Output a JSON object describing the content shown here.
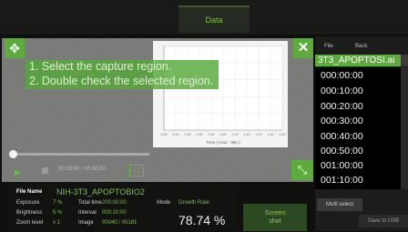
{
  "header": {
    "active_tab": "Data"
  },
  "preview": {
    "move_icon": "move-arrows-icon",
    "close_icon": "close-x-icon",
    "resize_icon": "resize-diagonal-icon",
    "instructions": [
      "1. Select the capture region.",
      "2. Double check the selected region."
    ]
  },
  "mini_chart": {
    "x_axis_label": "Time ( Hour : Min )",
    "x_ticks": [
      "0:00",
      "0:10",
      "0:20",
      "0:30",
      "0:40",
      "0:50",
      "1:00",
      "1:10",
      "1:20",
      "1:30",
      "1:40"
    ]
  },
  "playback": {
    "play_icon": "play-icon",
    "stop_icon": "stop-icon",
    "time_readout": "00:00:00 / 00:00:00",
    "snapshot_icon": "snapshot-icon",
    "progress": 0.0
  },
  "info": {
    "file_name_label": "File Name",
    "file_name": "NIH-3T3_APOPTOBIO2",
    "exposure_label": "Exposure",
    "exposure_value": "7 %",
    "brightness_label": "Brightness",
    "brightness_value": "5 %",
    "zoom_label": "Zoom level",
    "zoom_value": "x 1",
    "total_time_label": "Total time",
    "total_time_value": "200:00:00",
    "interval_label": "Interval",
    "interval_value": "000:10:00",
    "image_label": "Image",
    "image_value": "00040 / 00181",
    "mode_label": "Mode",
    "mode_value": "Growth Rate",
    "percent": "78.74 %"
  },
  "screenshot_button": {
    "line1": "Screen",
    "line2": "shot"
  },
  "file_list": {
    "tab_file": "File",
    "tab_back": "Back",
    "selected_file": "3T3_APOPTOSI.ai",
    "times": [
      "000:00:00",
      "000:10:00",
      "000:20:00",
      "000:30:00",
      "000:40:00",
      "000:50:00",
      "001:00:00",
      "001:10:00"
    ],
    "multi_select_label": "Multi select",
    "save_usb_label": "Save to USB"
  },
  "colors": {
    "accent": "#5cab3c",
    "background": "#0f100e"
  }
}
